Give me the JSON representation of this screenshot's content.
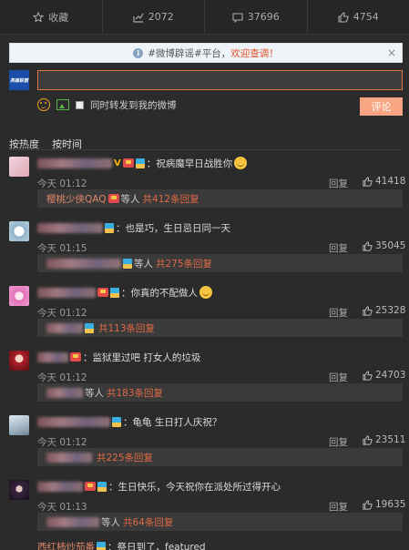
{
  "actions": [
    {
      "icon": "star-icon",
      "label": "收藏"
    },
    {
      "icon": "repost-icon",
      "label": "2072"
    },
    {
      "icon": "comment-icon",
      "label": "37696"
    },
    {
      "icon": "thumbs-up-icon",
      "label": "4754"
    }
  ],
  "notice": {
    "prefix": "#微博辟谣#平台，",
    "highlight": "欢迎查调！",
    "close": "×"
  },
  "composer": {
    "avatar_text": "英雄联盟",
    "also_repost": "同时转发到我的微博",
    "submit": "评论"
  },
  "sort_tabs": [
    "按热度",
    "按时间"
  ],
  "reply_label": "回复",
  "comments": [
    {
      "text": "：祝病魔早日战胜你",
      "time": "今天 01:12",
      "likes": "41418",
      "sub_name": "樱桃少侠QAQ",
      "sub_text": "等人",
      "sub_count": "共412条回复"
    },
    {
      "text": "：也是巧，生日忌日同一天",
      "time": "今天 01:15",
      "likes": "35045",
      "sub_name": "",
      "sub_text": "等人",
      "sub_count": "共275条回复"
    },
    {
      "text": "：你真的不配做人",
      "time": "今天 01:12",
      "likes": "25328",
      "sub_name": "",
      "sub_text": "",
      "sub_count": "共113条回复"
    },
    {
      "text": "：监狱里过吧 打女人的垃圾",
      "time": "今天 01:12",
      "likes": "24703",
      "sub_name": "",
      "sub_text": "等人",
      "sub_count": "共183条回复"
    },
    {
      "text": "：龟龟 生日打人庆祝？",
      "time": "今天 01:12",
      "likes": "23511",
      "sub_name": "",
      "sub_text": "",
      "sub_count": "共225条回复"
    },
    {
      "text": "：生日快乐，今天祝你在派处所过得开心",
      "time": "今天 01:13",
      "likes": "19635",
      "sub_name": "",
      "sub_text": "等人",
      "sub_count": "共64条回复"
    }
  ],
  "last_comment": {
    "name": "西红柿炒茄番",
    "text": "：祭日到了，featured"
  }
}
